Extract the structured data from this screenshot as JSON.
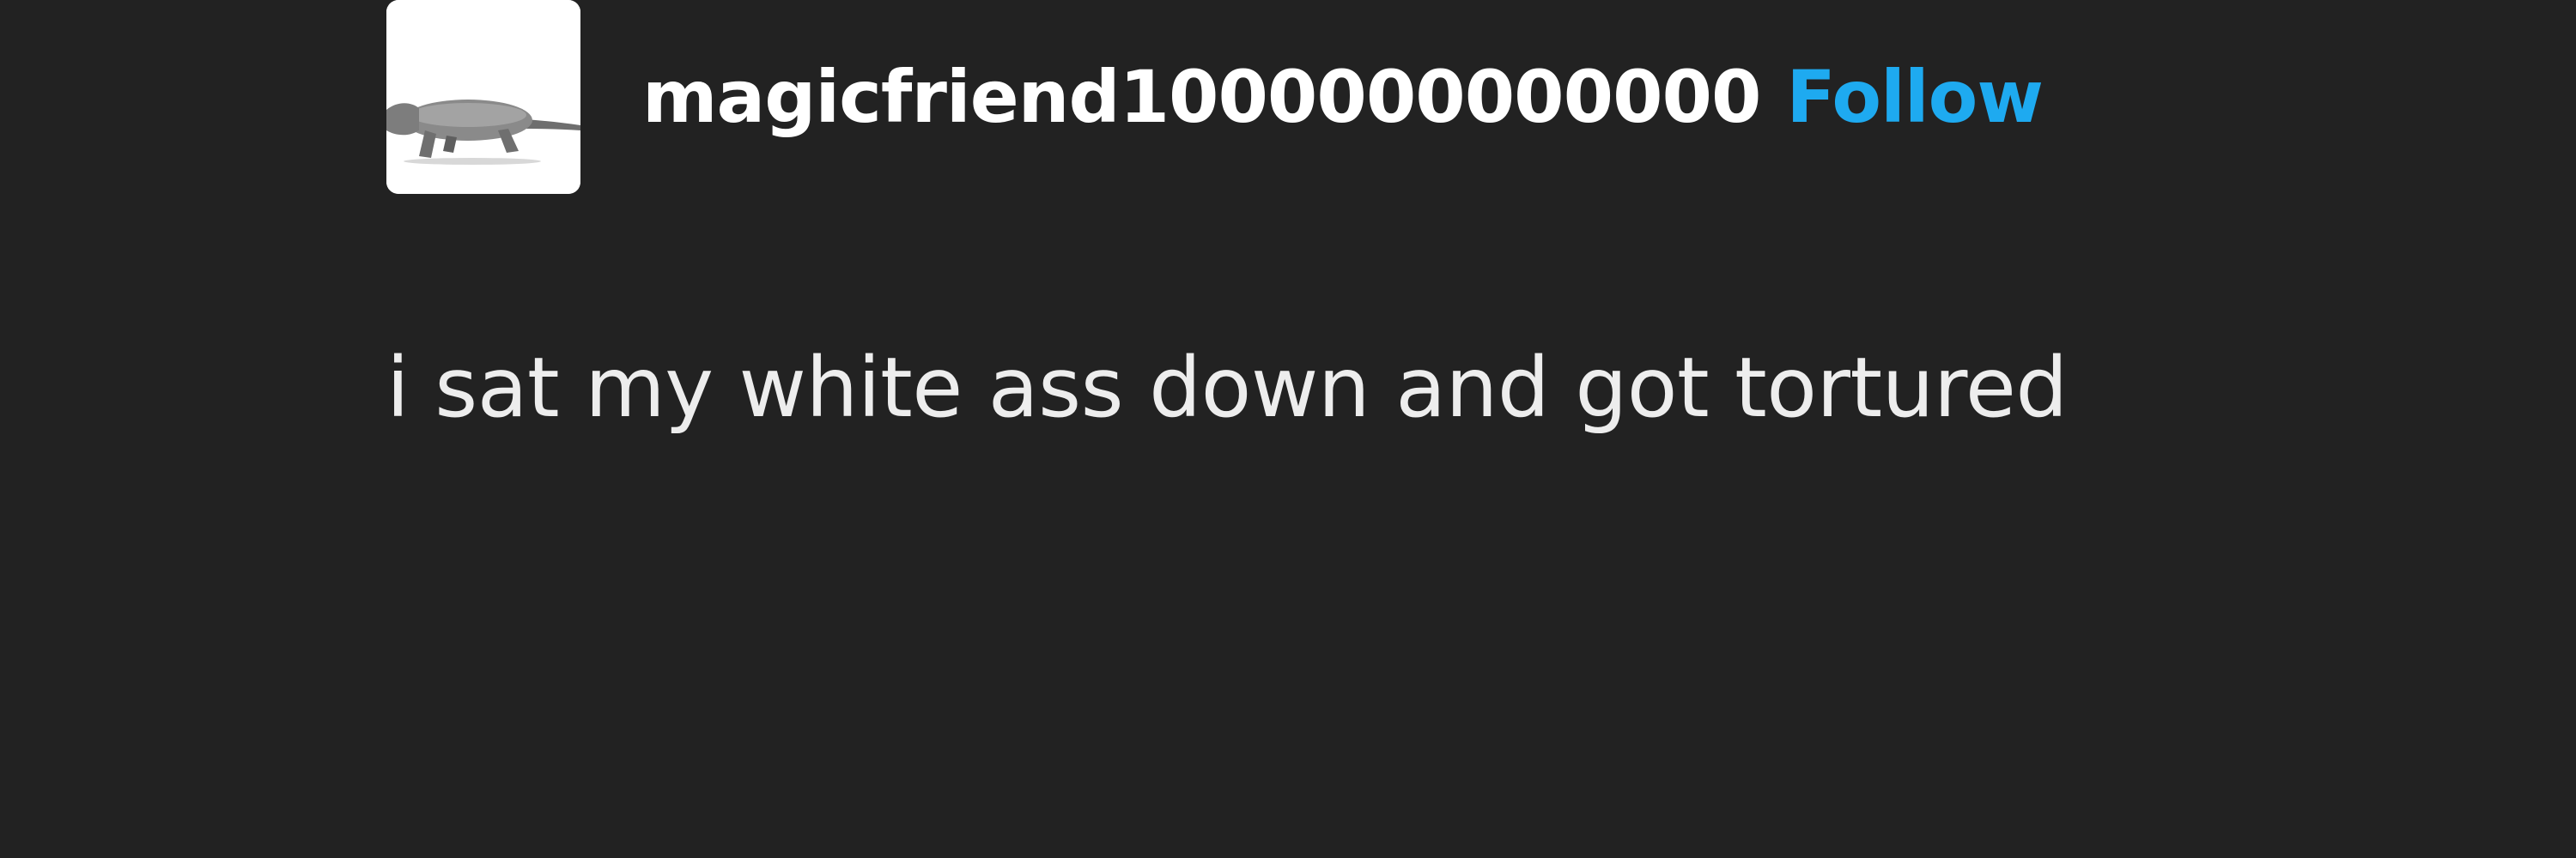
{
  "post": {
    "author": {
      "username": "magicfriend1000000000000",
      "avatar_icon": "salamander-avatar"
    },
    "follow_label": "Follow",
    "body_text": "i sat my white ass down and got tortured"
  },
  "colors": {
    "background": "#222222",
    "accent": "#1eaaf0",
    "text": "#eeeeee"
  }
}
